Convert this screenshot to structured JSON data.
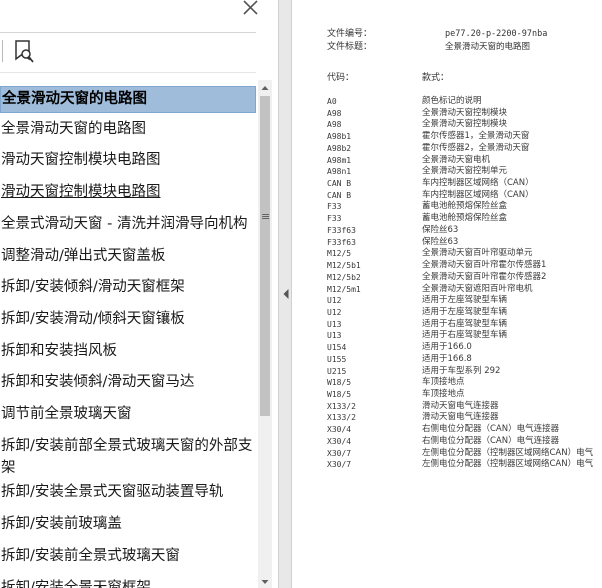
{
  "sidebar": {
    "items": [
      {
        "label": "全景滑动天窗的电路图",
        "selected": true
      },
      {
        "label": "全景滑动天窗的电路图"
      },
      {
        "label": "滑动天窗控制模块电路图"
      },
      {
        "label": "滑动天窗控制模块电路图",
        "underline": true
      },
      {
        "label": "全景式滑动天窗 - 清洗并润滑导向机构"
      },
      {
        "label": "调整滑动/弹出式天窗盖板"
      },
      {
        "label": "拆卸/安装倾斜/滑动天窗框架"
      },
      {
        "label": "拆卸/安装滑动/倾斜天窗镶板"
      },
      {
        "label": "拆卸和安装挡风板"
      },
      {
        "label": "拆卸和安装倾斜/滑动天窗马达"
      },
      {
        "label": "调节前全景玻璃天窗"
      },
      {
        "label": "拆卸/安装前部全景式玻璃天窗的外部支架",
        "wrap": true
      },
      {
        "label": "拆卸/安装全景式天窗驱动装置导轨"
      },
      {
        "label": "拆卸/安装前玻璃盖"
      },
      {
        "label": "拆卸/安装前全景式玻璃天窗"
      },
      {
        "label": "拆卸/安装全景天窗框架"
      }
    ]
  },
  "document": {
    "file_no_label": "文件编号：",
    "file_no_value": "pe77.20-p-2200-97nba",
    "file_title_label": "文件标题：",
    "file_title_value": "全景滑动天窗的电路图",
    "code_header": "代码：",
    "desc_header": "款式：",
    "rows": [
      {
        "code": "A0",
        "desc": "颜色标记的说明"
      },
      {
        "code": "A98",
        "desc": "全景滑动天窗控制模块"
      },
      {
        "code": "A98",
        "desc": "全景滑动天窗控制模块"
      },
      {
        "code": "A98b1",
        "desc": "霍尔传感器1，全景滑动天窗"
      },
      {
        "code": "A98b2",
        "desc": "霍尔传感器2，全景滑动天窗"
      },
      {
        "code": "A98m1",
        "desc": "全景滑动天窗电机"
      },
      {
        "code": "A98n1",
        "desc": "全景滑动天窗控制单元"
      },
      {
        "code": "CAN B",
        "desc": "车内控制器区域网络（CAN）"
      },
      {
        "code": "CAN B",
        "desc": "车内控制器区域网络（CAN）"
      },
      {
        "code": "F33",
        "desc": "蓄电池舱预熔保险丝盒"
      },
      {
        "code": "F33",
        "desc": "蓄电池舱预熔保险丝盒"
      },
      {
        "code": "F33f63",
        "desc": "保险丝63"
      },
      {
        "code": "F33f63",
        "desc": "保险丝63"
      },
      {
        "code": "M12/5",
        "desc": "全景滑动天窗百叶帘驱动单元"
      },
      {
        "code": "M12/5b1",
        "desc": "全景滑动天窗百叶帘霍尔传感器1"
      },
      {
        "code": "M12/5b2",
        "desc": "全景滑动天窗百叶帘霍尔传感器2"
      },
      {
        "code": "M12/5m1",
        "desc": "全景滑动天窗遮阳百叶帘电机"
      },
      {
        "code": "U12",
        "desc": "适用于左座驾驶型车辆"
      },
      {
        "code": "U12",
        "desc": "适用于左座驾驶型车辆"
      },
      {
        "code": "U13",
        "desc": "适用于右座驾驶型车辆"
      },
      {
        "code": "U13",
        "desc": "适用于右座驾驶型车辆"
      },
      {
        "code": "U154",
        "desc": "适用于166.0"
      },
      {
        "code": "U155",
        "desc": "适用于166.8"
      },
      {
        "code": "U215",
        "desc": "适用于车型系列 292"
      },
      {
        "code": "W18/5",
        "desc": "车顶接地点"
      },
      {
        "code": "W18/5",
        "desc": "车顶接地点"
      },
      {
        "code": "X133/2",
        "desc": "滑动天窗电气连接器"
      },
      {
        "code": "X133/2",
        "desc": "滑动天窗电气连接器"
      },
      {
        "code": "X30/4",
        "desc": "右侧电位分配器（CAN）电气连接器"
      },
      {
        "code": "X30/4",
        "desc": "右侧电位分配器（CAN）电气连接器"
      },
      {
        "code": "X30/7",
        "desc": "左侧电位分配器（控制器区域网络CAN）电气"
      },
      {
        "code": "X30/7",
        "desc": "左侧电位分配器（控制器区域网络CAN）电气"
      }
    ]
  },
  "icons": {
    "close": "close-icon",
    "bookmark": "bookmark-search-icon",
    "collapse": "chevron-left-icon",
    "resize": "grip-icon"
  }
}
